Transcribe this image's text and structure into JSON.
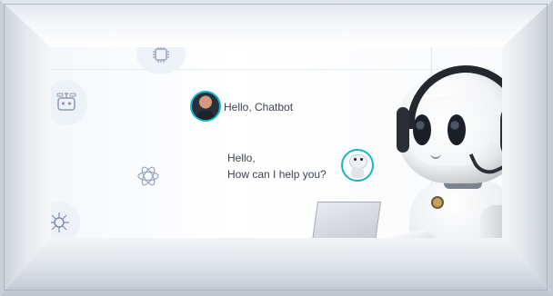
{
  "chat": {
    "user_message": "Hello, Chatbot",
    "bot_message_line1": "Hello,",
    "bot_message_line2": "How can I help you?"
  },
  "icons": {
    "user_avatar": "person-avatar",
    "bot_avatar": "robot-avatar",
    "background_icons": [
      "brain-chip-icon",
      "robot-face-icon",
      "ai-atom-icon",
      "circuit-brain-icon",
      "chat-bubble-icon"
    ]
  },
  "colors": {
    "accent": "#19b3c8",
    "text": "#3c4250",
    "background": "#ffffff"
  }
}
